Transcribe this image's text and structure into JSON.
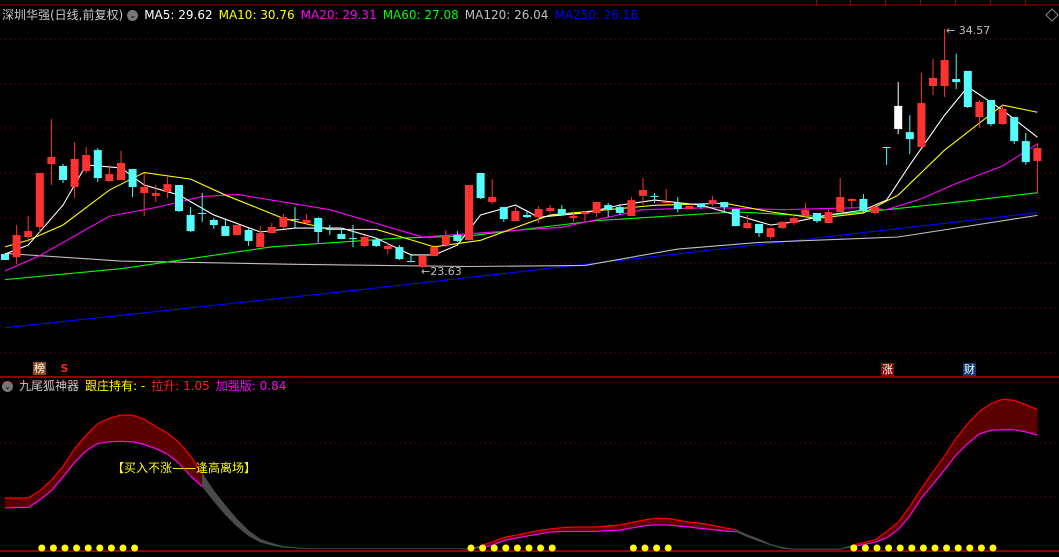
{
  "header": {
    "title": "深圳华强(日线,前复权)",
    "ma": [
      {
        "label": "MA5: 29.62",
        "color": "#ffffff"
      },
      {
        "label": "MA10: 30.76",
        "color": "#ffff00"
      },
      {
        "label": "MA20: 29.31",
        "color": "#ff00ff"
      },
      {
        "label": "MA60: 27.08",
        "color": "#00ff00"
      },
      {
        "label": "MA120: 26.04",
        "color": "#c0c0c0"
      },
      {
        "label": "MA250: 26.16",
        "color": "#0000ff"
      }
    ]
  },
  "indicator_header": {
    "name": "九尾狐神器",
    "hold": "跟庄持有: -",
    "rise": "拉升: 1.05",
    "enhanced": "加强版: 0.84"
  },
  "markers": {
    "bang": "榜",
    "s": "S",
    "zhang": "涨",
    "cai": "财"
  },
  "price_labels": {
    "high": "34.57",
    "low": "23.63",
    "arrow": "←"
  },
  "signal_text": "【买入不涨——逢高离场】",
  "colors": {
    "up": "#ff3232",
    "down": "#54fcfc",
    "band_up": "#5a0000",
    "band_down": "#4a4a4a",
    "grid": "#8a0000"
  },
  "chart_data": [
    {
      "type": "candlestick",
      "title": "深圳华强(日线,前复权)",
      "ylim": [
        19.4,
        35.0
      ],
      "candles_ohlc": [
        [
          24.27,
          24.27,
          24.0,
          24.0
        ],
        [
          24.13,
          25.6,
          23.81,
          25.14
        ],
        [
          25.05,
          26.01,
          24.82,
          25.32
        ],
        [
          25.51,
          27.98,
          25.23,
          27.98
        ],
        [
          28.39,
          30.45,
          27.43,
          28.71
        ],
        [
          28.3,
          28.39,
          27.52,
          27.66
        ],
        [
          27.34,
          29.4,
          26.83,
          28.62
        ],
        [
          28.07,
          29.17,
          27.98,
          28.8
        ],
        [
          29.03,
          29.12,
          27.57,
          27.75
        ],
        [
          27.61,
          28.35,
          27.57,
          27.93
        ],
        [
          27.66,
          28.99,
          27.66,
          28.44
        ],
        [
          28.16,
          28.16,
          26.88,
          27.34
        ],
        [
          27.06,
          27.98,
          26.01,
          27.34
        ],
        [
          26.93,
          27.43,
          26.65,
          27.06
        ],
        [
          27.11,
          27.8,
          26.83,
          27.47
        ],
        [
          27.43,
          27.43,
          26.19,
          26.24
        ],
        [
          26.06,
          26.42,
          25.28,
          25.32
        ],
        [
          26.15,
          27.06,
          25.74,
          26.15
        ],
        [
          25.83,
          25.92,
          25.42,
          25.6
        ],
        [
          25.55,
          25.87,
          25.1,
          25.1
        ],
        [
          25.14,
          25.6,
          25.14,
          25.6
        ],
        [
          25.37,
          25.46,
          24.64,
          24.87
        ],
        [
          24.59,
          25.55,
          24.59,
          25.23
        ],
        [
          25.23,
          25.69,
          25.23,
          25.51
        ],
        [
          25.51,
          26.1,
          25.42,
          25.96
        ],
        [
          25.87,
          26.42,
          25.42,
          25.87
        ],
        [
          25.69,
          26.1,
          25.6,
          25.83
        ],
        [
          25.92,
          25.96,
          24.78,
          25.28
        ],
        [
          25.42,
          25.6,
          25.14,
          25.42
        ],
        [
          25.19,
          25.46,
          24.96,
          24.96
        ],
        [
          25.0,
          25.6,
          24.59,
          25.0
        ],
        [
          24.64,
          25.14,
          24.59,
          25.05
        ],
        [
          24.91,
          25.0,
          24.59,
          24.64
        ],
        [
          24.5,
          24.78,
          24.27,
          24.64
        ],
        [
          24.59,
          24.68,
          24.0,
          24.04
        ],
        [
          23.95,
          24.27,
          23.9,
          23.95
        ],
        [
          23.68,
          24.18,
          23.63,
          24.18
        ],
        [
          24.18,
          24.68,
          24.18,
          24.59
        ],
        [
          24.68,
          25.37,
          24.59,
          25.14
        ],
        [
          25.14,
          25.32,
          24.82,
          24.87
        ],
        [
          24.91,
          27.43,
          24.91,
          27.43
        ],
        [
          27.98,
          27.98,
          26.79,
          26.83
        ],
        [
          26.65,
          27.7,
          26.56,
          26.88
        ],
        [
          26.42,
          26.42,
          25.74,
          25.87
        ],
        [
          25.78,
          26.42,
          25.78,
          26.24
        ],
        [
          26.06,
          26.28,
          25.92,
          25.96
        ],
        [
          25.96,
          26.47,
          25.69,
          26.33
        ],
        [
          26.24,
          26.51,
          26.15,
          26.38
        ],
        [
          26.33,
          26.51,
          26.01,
          26.06
        ],
        [
          25.92,
          26.15,
          25.74,
          26.01
        ],
        [
          26.1,
          26.24,
          25.74,
          26.19
        ],
        [
          26.15,
          26.65,
          25.96,
          26.65
        ],
        [
          26.51,
          26.61,
          25.96,
          26.33
        ],
        [
          26.42,
          26.56,
          26.06,
          26.15
        ],
        [
          26.01,
          26.88,
          26.01,
          26.74
        ],
        [
          26.93,
          27.75,
          26.51,
          27.2
        ],
        [
          26.93,
          27.06,
          26.61,
          26.93
        ],
        [
          26.65,
          27.25,
          26.61,
          26.65
        ],
        [
          26.61,
          26.88,
          26.19,
          26.33
        ],
        [
          26.33,
          26.47,
          26.33,
          26.47
        ],
        [
          26.56,
          26.56,
          26.33,
          26.42
        ],
        [
          26.56,
          26.93,
          26.47,
          26.74
        ],
        [
          26.65,
          26.65,
          26.19,
          26.42
        ],
        [
          26.33,
          26.33,
          25.55,
          25.55
        ],
        [
          25.46,
          26.06,
          25.42,
          25.69
        ],
        [
          25.65,
          25.65,
          25.05,
          25.23
        ],
        [
          25.05,
          25.46,
          24.96,
          25.46
        ],
        [
          25.46,
          25.78,
          25.42,
          25.74
        ],
        [
          25.69,
          26.06,
          25.6,
          25.92
        ],
        [
          26.01,
          26.61,
          25.96,
          26.28
        ],
        [
          26.15,
          26.15,
          25.69,
          25.78
        ],
        [
          25.69,
          26.33,
          25.69,
          26.19
        ],
        [
          26.19,
          27.75,
          26.19,
          26.88
        ],
        [
          26.7,
          26.83,
          26.42,
          26.79
        ],
        [
          26.79,
          27.02,
          26.19,
          26.24
        ],
        [
          26.15,
          26.51,
          26.06,
          26.42
        ],
        [
          29.17,
          29.17,
          28.35,
          29.17
        ],
        [
          31.05,
          32.14,
          29.76,
          29.99
        ],
        [
          29.85,
          30.63,
          28.85,
          29.53
        ],
        [
          29.17,
          32.56,
          29.17,
          31.18
        ],
        [
          31.96,
          33.2,
          31.55,
          32.33
        ],
        [
          31.96,
          34.57,
          31.46,
          33.15
        ],
        [
          32.28,
          33.43,
          31.82,
          32.14
        ],
        [
          32.65,
          32.65,
          30.95,
          31.0
        ],
        [
          30.54,
          31.32,
          30.04,
          31.23
        ],
        [
          31.32,
          31.32,
          30.13,
          30.22
        ],
        [
          30.22,
          31.09,
          30.17,
          30.91
        ],
        [
          30.54,
          30.54,
          29.31,
          29.44
        ],
        [
          29.44,
          29.81,
          28.35,
          28.48
        ],
        [
          28.53,
          29.35,
          27.02,
          29.12
        ]
      ],
      "flat_candle_colors": {
        "57": "#ff3232",
        "77": "#ffffff"
      },
      "moving_averages": [
        {
          "name": "MA5",
          "color": "#ffffff",
          "points": [
            [
              0,
              24.27
            ],
            [
              2,
              24.68
            ],
            [
              5,
              26.51
            ],
            [
              7,
              28.35
            ],
            [
              10,
              28.21
            ],
            [
              12,
              27.43
            ],
            [
              15,
              26.97
            ],
            [
              18,
              26.06
            ],
            [
              22,
              25.28
            ],
            [
              25,
              25.46
            ],
            [
              29,
              25.46
            ],
            [
              32,
              25.0
            ],
            [
              35,
              24.23
            ],
            [
              37,
              24.23
            ],
            [
              39,
              24.68
            ],
            [
              41,
              26.06
            ],
            [
              44,
              26.51
            ],
            [
              46,
              25.96
            ],
            [
              50,
              26.15
            ],
            [
              53,
              26.51
            ],
            [
              56,
              26.74
            ],
            [
              60,
              26.51
            ],
            [
              63,
              26.06
            ],
            [
              66,
              25.6
            ],
            [
              68,
              25.74
            ],
            [
              71,
              26.06
            ],
            [
              74,
              26.28
            ],
            [
              76,
              26.74
            ],
            [
              78,
              28.35
            ],
            [
              81,
              30.63
            ],
            [
              83,
              31.92
            ],
            [
              86,
              30.86
            ],
            [
              89,
              29.62
            ]
          ]
        },
        {
          "name": "MA10",
          "color": "#ffff00",
          "points": [
            [
              0,
              24.6
            ],
            [
              2,
              24.9
            ],
            [
              5,
              25.6
            ],
            [
              9,
              27.2
            ],
            [
              12,
              28.0
            ],
            [
              16,
              27.7
            ],
            [
              19,
              26.97
            ],
            [
              24,
              25.9
            ],
            [
              28,
              25.4
            ],
            [
              32,
              25.4
            ],
            [
              37,
              24.6
            ],
            [
              41,
              24.9
            ],
            [
              47,
              26.06
            ],
            [
              56,
              26.5
            ],
            [
              62,
              26.6
            ],
            [
              66,
              26.2
            ],
            [
              70,
              25.9
            ],
            [
              74,
              26.15
            ],
            [
              77,
              26.97
            ],
            [
              81,
              29.03
            ],
            [
              86,
              31.09
            ],
            [
              89,
              30.76
            ]
          ]
        },
        {
          "name": "MA20",
          "color": "#ff00ff",
          "points": [
            [
              0,
              23.5
            ],
            [
              3,
              24.2
            ],
            [
              9,
              26.0
            ],
            [
              13,
              26.4
            ],
            [
              17,
              26.9
            ],
            [
              20,
              27.0
            ],
            [
              28,
              26.3
            ],
            [
              36,
              25.05
            ],
            [
              40,
              25.2
            ],
            [
              48,
              25.5
            ],
            [
              55,
              26.3
            ],
            [
              61,
              26.4
            ],
            [
              67,
              26.3
            ],
            [
              74,
              26.4
            ],
            [
              76,
              26.3
            ],
            [
              79,
              26.8
            ],
            [
              82,
              27.5
            ],
            [
              86,
              28.3
            ],
            [
              89,
              29.31
            ]
          ]
        },
        {
          "name": "MA60",
          "color": "#00ff00",
          "points": [
            [
              0,
              23.1
            ],
            [
              10,
              23.6
            ],
            [
              23,
              24.6
            ],
            [
              34,
              25.0
            ],
            [
              40,
              25.1
            ],
            [
              51,
              25.8
            ],
            [
              63,
              26.2
            ],
            [
              70,
              26.0
            ],
            [
              76,
              26.3
            ],
            [
              83,
              26.7
            ],
            [
              89,
              27.08
            ]
          ]
        },
        {
          "name": "MA120",
          "color": "#c0c0c0",
          "points": [
            [
              0,
              24.3
            ],
            [
              10,
              23.95
            ],
            [
              25,
              23.8
            ],
            [
              40,
              23.7
            ],
            [
              50,
              23.75
            ],
            [
              58,
              24.5
            ],
            [
              65,
              24.8
            ],
            [
              77,
              25.05
            ],
            [
              89,
              26.04
            ]
          ]
        },
        {
          "name": "MA250",
          "color": "#0000ff",
          "points": [
            [
              0,
              20.9
            ],
            [
              30,
              22.6
            ],
            [
              60,
              24.4
            ],
            [
              89,
              26.16
            ]
          ]
        }
      ]
    },
    {
      "type": "area",
      "title": "九尾狐神器",
      "ylim": [
        0,
        75
      ],
      "upper": [
        24.5,
        24.5,
        24.5,
        28,
        33,
        39.5,
        48,
        54.5,
        60,
        62.5,
        64,
        64,
        62,
        58.5,
        55.5,
        51,
        44.5,
        36.5,
        28,
        21,
        14.5,
        9,
        5,
        3,
        1.5,
        1,
        0.5,
        0.5,
        0.5,
        0.5,
        0.5,
        0.5,
        0.5,
        0.5,
        0.5,
        0.5,
        0.5,
        0.5,
        0.5,
        0.5,
        0.3,
        1.8,
        3.5,
        5.8,
        6.8,
        7.9,
        9,
        9.8,
        10.4,
        10.7,
        10.7,
        10.7,
        11.2,
        11.7,
        12.8,
        14,
        14.8,
        14.8,
        14,
        13,
        12.5,
        11.5,
        10.4,
        9.5,
        7,
        5,
        2.5,
        1,
        0.3,
        0.3,
        0.3,
        0.3,
        0.3,
        2,
        3.3,
        4.5,
        8.5,
        13,
        20.5,
        29,
        37,
        44.5,
        53,
        60,
        65.7,
        69.5,
        71.6,
        71,
        69,
        66.5
      ],
      "lower": [
        19.8,
        20,
        20,
        23.6,
        28,
        34.5,
        41.5,
        47,
        50.5,
        51.3,
        51.5,
        51.3,
        50,
        48,
        45.5,
        41,
        35,
        30,
        23,
        16.5,
        11,
        6.5,
        3.5,
        2,
        1,
        0.7,
        0.3,
        0.3,
        0.3,
        0.3,
        0.3,
        0.3,
        0.3,
        0.3,
        0.3,
        0.3,
        0.3,
        0.3,
        0.3,
        0.3,
        0,
        0.8,
        2,
        4.3,
        5.3,
        6.4,
        7.3,
        8.3,
        8.6,
        8.6,
        8.6,
        8.6,
        9,
        9.2,
        10.2,
        11.2,
        11.7,
        11.7,
        11.2,
        10.7,
        10,
        9.5,
        8.8,
        8.5,
        6,
        4,
        2,
        0.5,
        0,
        0,
        0,
        0,
        0,
        1.3,
        2.3,
        3.5,
        5.5,
        9.5,
        16,
        24.5,
        31,
        38,
        45,
        50.5,
        55,
        56.8,
        57,
        57,
        56,
        54.5
      ],
      "trend": "rrrrrrrrrrrrrrrrrggggggggggggggggggggggggrrrrrrrrrrrrrrrrrrrrrrggggggggggrrrrrrrrrrrrrrrrr",
      "signal_dots": [
        3,
        4,
        5,
        6,
        7,
        8,
        9,
        10,
        11,
        40,
        41,
        42,
        43,
        44,
        45,
        46,
        47,
        54,
        55,
        56,
        57,
        73,
        74,
        75,
        76,
        77,
        78,
        79,
        80,
        81,
        82,
        83,
        84,
        85
      ]
    }
  ]
}
